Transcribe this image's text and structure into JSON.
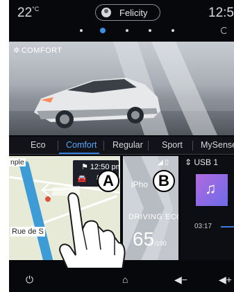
{
  "status": {
    "temperature": "22",
    "temperature_unit": "°C",
    "profile_name": "Felicity",
    "clock": "12:5"
  },
  "page_indicator": {
    "count": 5,
    "active_index": 1
  },
  "hero": {
    "mode_label": "COMFORT"
  },
  "modes": {
    "items": [
      "Eco",
      "Comfort",
      "Regular",
      "Sport",
      "MySense"
    ],
    "selected": "Comfort"
  },
  "navigation": {
    "street_top": "nple",
    "arrival_time": "12:50 pm",
    "distance": "8 5",
    "street_bottom": "Rue de S"
  },
  "driving_eco": {
    "source_label": "iPho",
    "title": "DRIVING ECO2",
    "score": "65",
    "score_unit": "/100"
  },
  "media": {
    "source": "USB 1",
    "elapsed": "03:17"
  },
  "callouts": {
    "a": "A",
    "b": "B"
  },
  "colors": {
    "accent": "#3c8fe0",
    "selected_mode": "#58a6ff",
    "album": "#8f6ce6"
  },
  "icons": {
    "power": "power-icon",
    "home": "home-icon",
    "volume_down": "volume-down-icon",
    "volume_up": "volume-up-icon"
  }
}
